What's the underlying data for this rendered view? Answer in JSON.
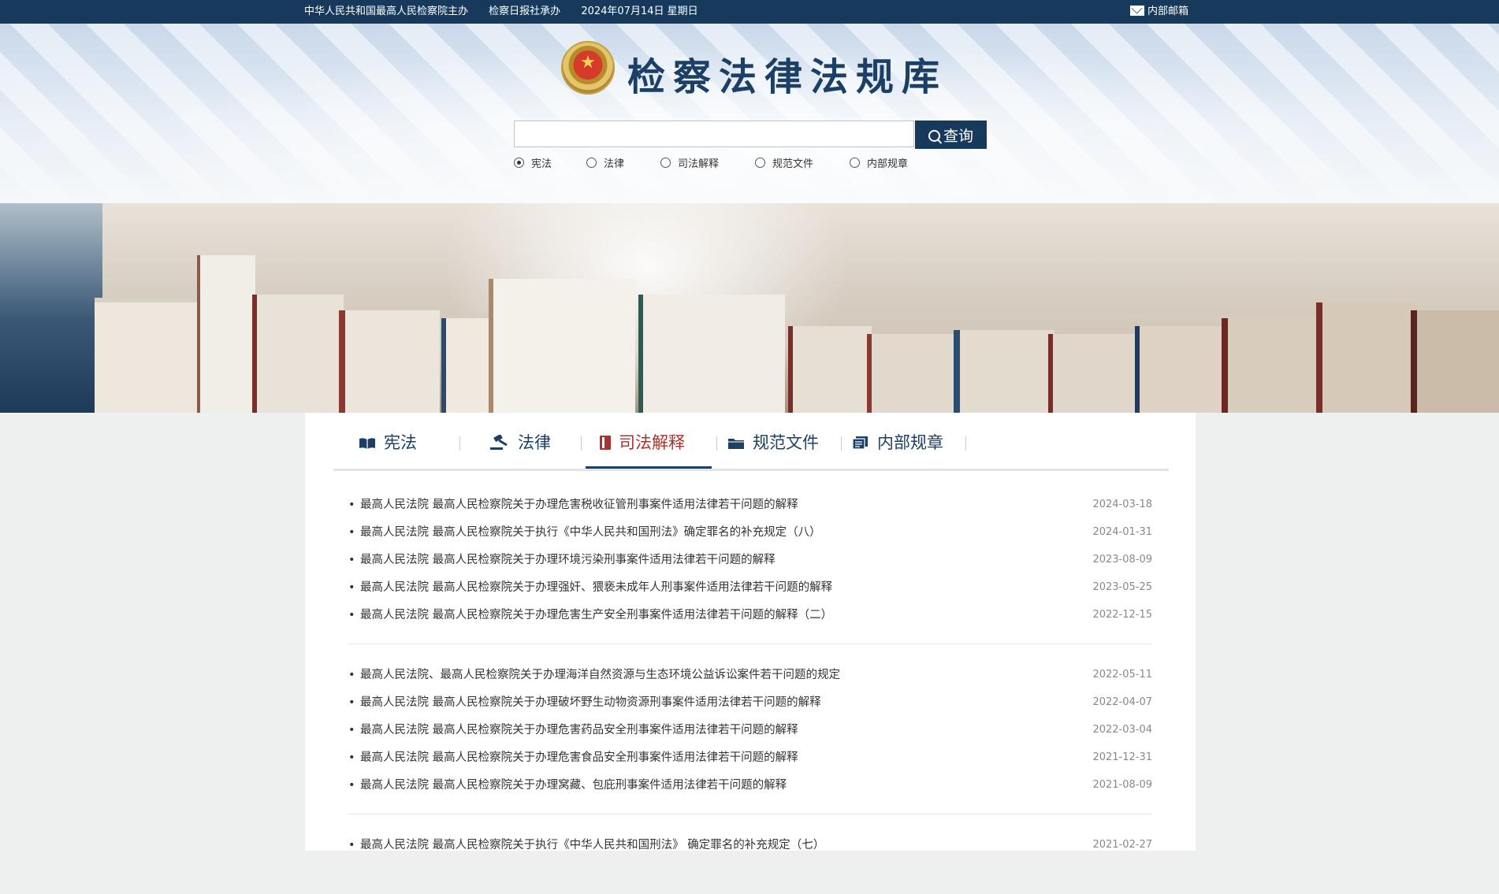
{
  "topbar": {
    "host": "中华人民共和国最高人民检察院主办",
    "organizer": "检察日报社承办",
    "date": "2024年07月14日 星期日",
    "mail_label": "内部邮箱"
  },
  "header": {
    "title": "检察法律法规库",
    "search_button": "查询",
    "search_value": "",
    "radio_options": [
      "宪法",
      "法律",
      "司法解释",
      "规范文件",
      "内部规章"
    ],
    "radio_selected": "宪法"
  },
  "tabs": [
    {
      "label": "宪法",
      "icon": "book-icon"
    },
    {
      "label": "法律",
      "icon": "gavel-icon"
    },
    {
      "label": "司法解释",
      "icon": "notebook-icon"
    },
    {
      "label": "规范文件",
      "icon": "folder-icon"
    },
    {
      "label": "内部规章",
      "icon": "document-stack-icon"
    }
  ],
  "active_tab": "司法解释",
  "colors": {
    "navy": "#173a5c",
    "active_red": "#a8322d",
    "date_gray": "#888888"
  },
  "list_groups": [
    [
      {
        "title": "最高人民法院 最高人民检察院关于办理危害税收征管刑事案件适用法律若干问题的解释",
        "date": "2024-03-18"
      },
      {
        "title": "最高人民法院 最高人民检察院关于执行《中华人民共和国刑法》确定罪名的补充规定（八）",
        "date": "2024-01-31"
      },
      {
        "title": "最高人民法院 最高人民检察院关于办理环境污染刑事案件适用法律若干问题的解释",
        "date": "2023-08-09"
      },
      {
        "title": "最高人民法院 最高人民检察院关于办理强奸、猥亵未成年人刑事案件适用法律若干问题的解释",
        "date": "2023-05-25"
      },
      {
        "title": "最高人民法院  最高人民检察院关于办理危害生产安全刑事案件适用法律若干问题的解释（二）",
        "date": "2022-12-15"
      }
    ],
    [
      {
        "title": "最高人民法院、最高人民检察院关于办理海洋自然资源与生态环境公益诉讼案件若干问题的规定",
        "date": "2022-05-11"
      },
      {
        "title": "最高人民法院 最高人民检察院关于办理破坏野生动物资源刑事案件适用法律若干问题的解释",
        "date": "2022-04-07"
      },
      {
        "title": "最高人民法院   最高人民检察院关于办理危害药品安全刑事案件适用法律若干问题的解释",
        "date": "2022-03-04"
      },
      {
        "title": "最高人民法院  最高人民检察院关于办理危害食品安全刑事案件适用法律若干问题的解释",
        "date": "2021-12-31"
      },
      {
        "title": "最高人民法院 最高人民检察院关于办理窝藏、包庇刑事案件适用法律若干问题的解释",
        "date": "2021-08-09"
      }
    ],
    [
      {
        "title": "最高人民法院 最高人民检察院关于执行《中华人民共和国刑法》 确定罪名的补充规定（七）",
        "date": "2021-02-27"
      }
    ]
  ]
}
